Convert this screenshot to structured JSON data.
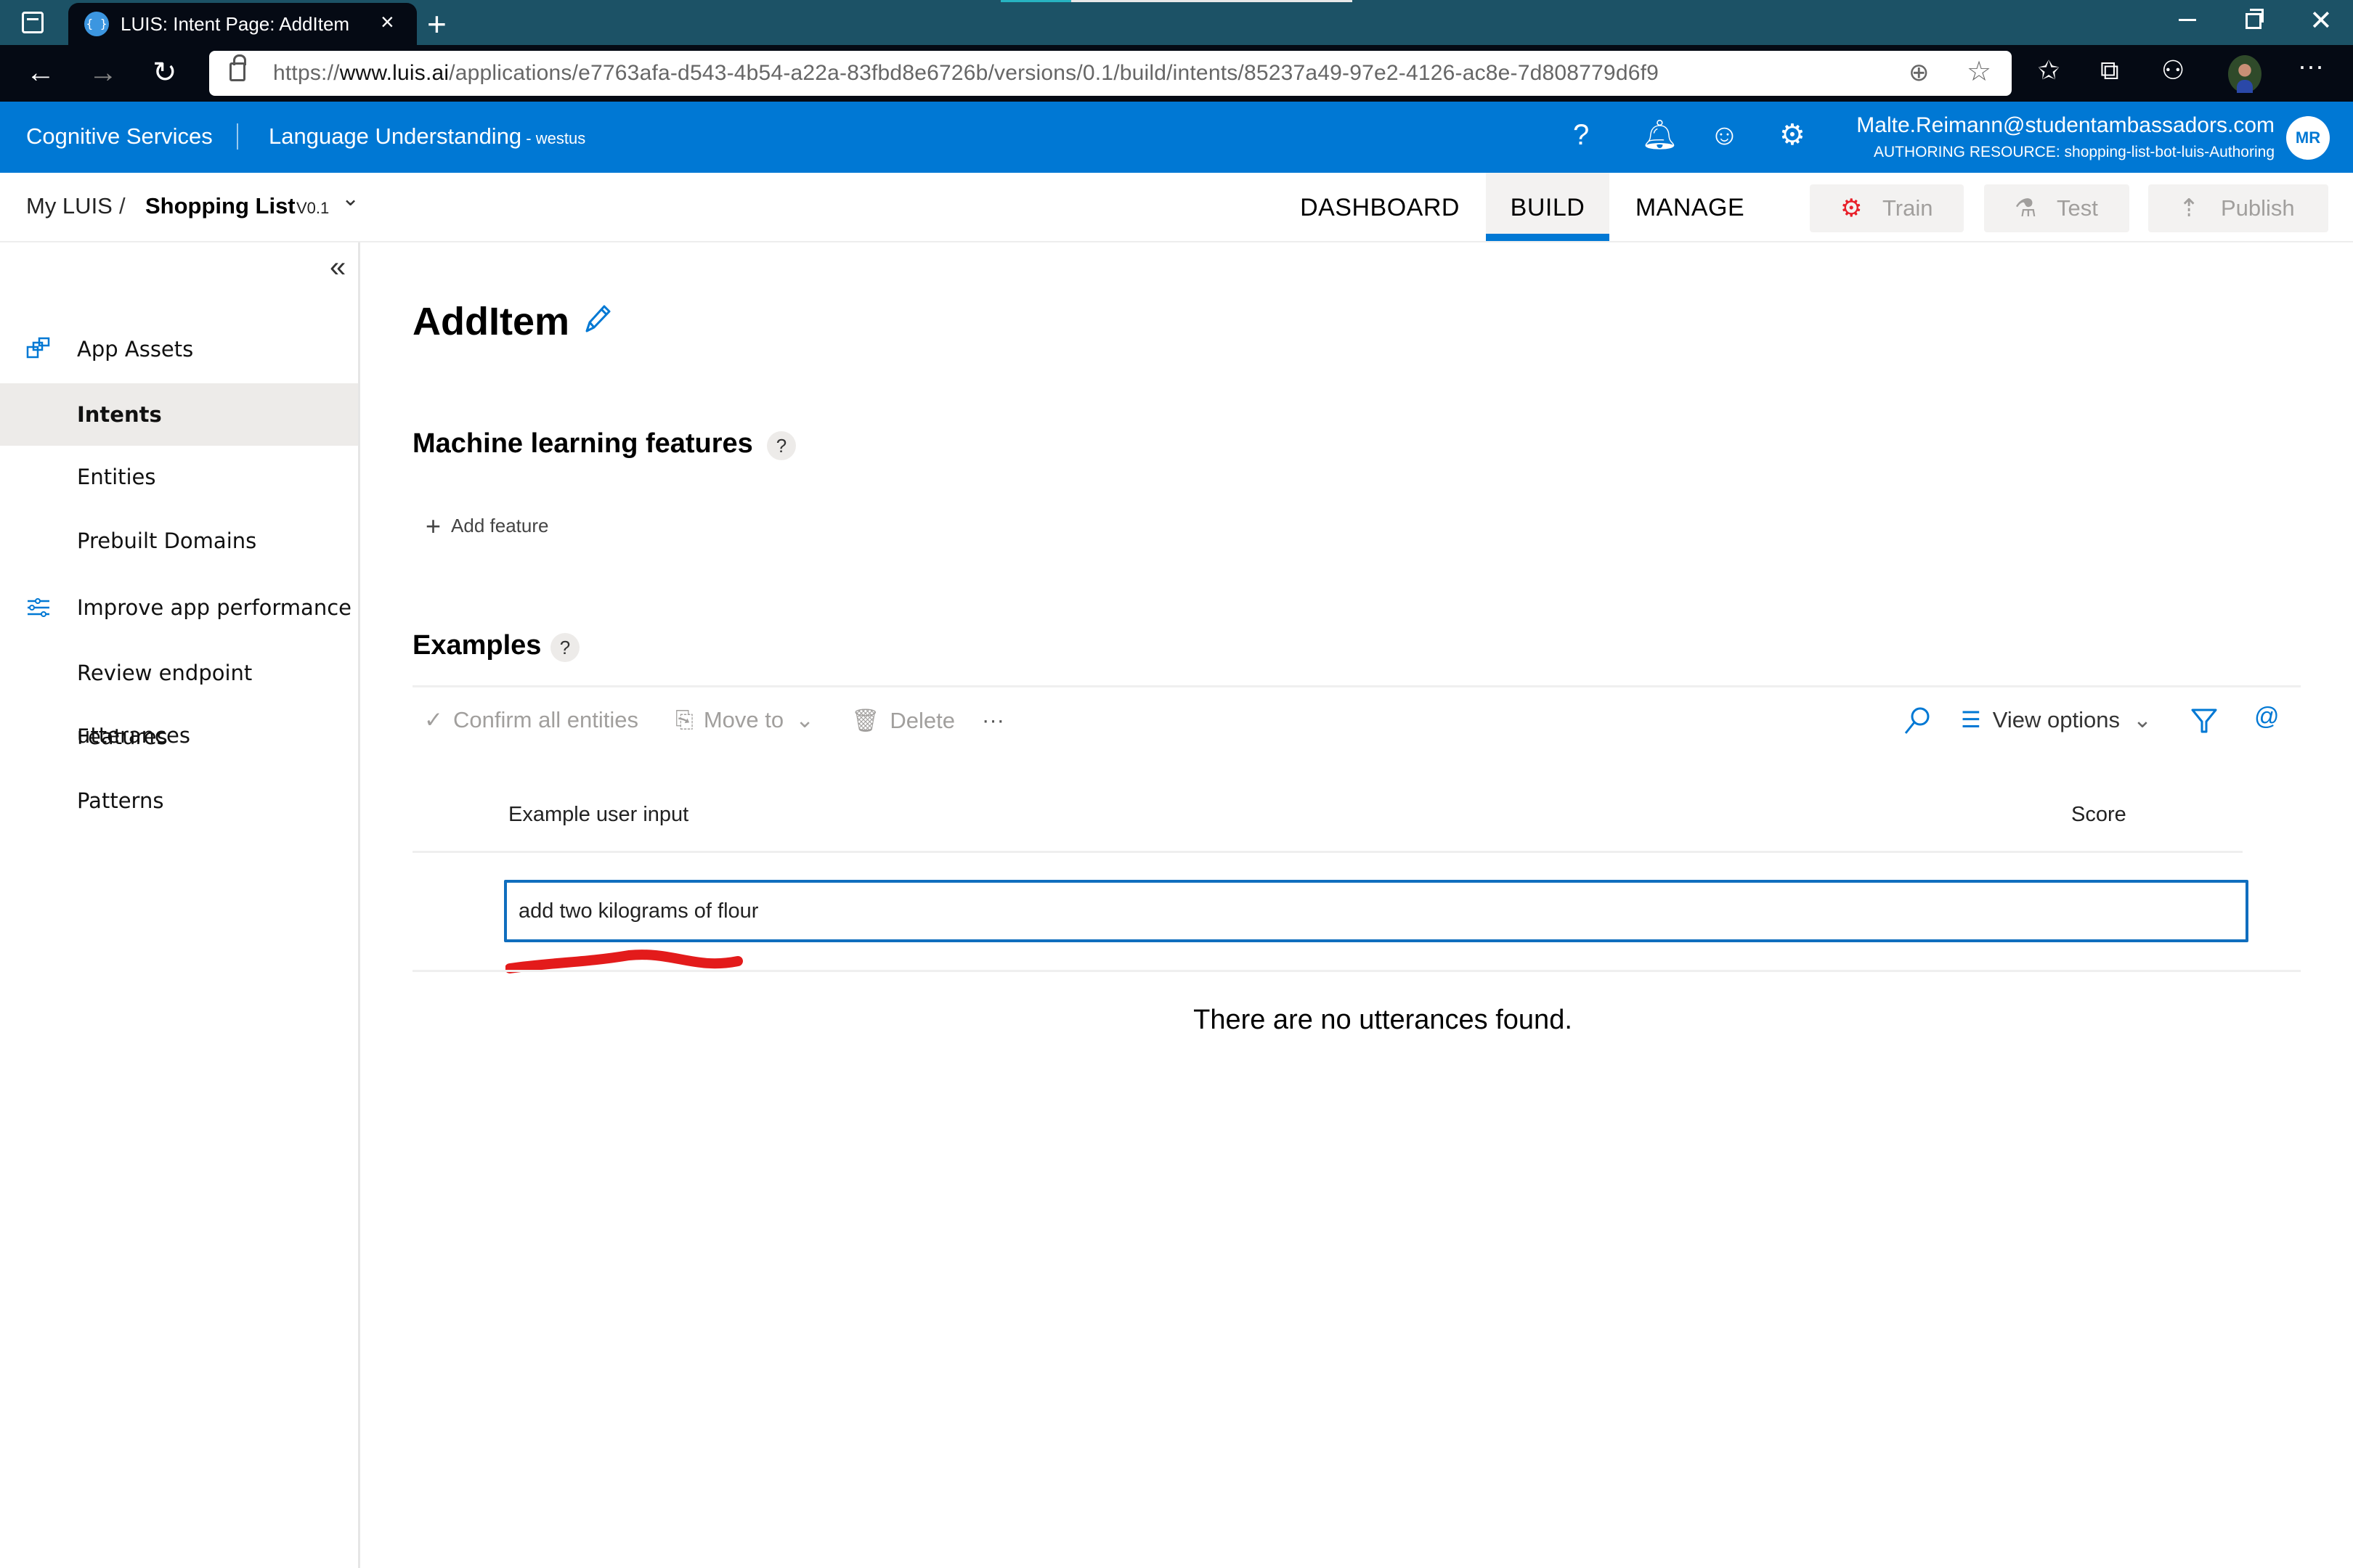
{
  "browser": {
    "tab_title": "LUIS: Intent Page: AddItem",
    "tab_favicon": "{ }",
    "new_tab_icon": "+",
    "close_tab_icon": "×",
    "page_load_progress": 0.2,
    "url_prefix": "https://",
    "url_domain": "www.luis.ai",
    "url_path": "/applications/e7763afa-d543-4b54-a22a-83fbd8e6726b/versions/0.1/build/intents/85237a49-97e2-4126-ac8e-7d808779d6f9",
    "toolbar_icons": [
      "favorites-icon",
      "collections-icon",
      "share-icon",
      "profile-avatar",
      "more-icon"
    ]
  },
  "header": {
    "brand": "Cognitive Services",
    "product": "Language Understanding",
    "region": " - westus",
    "user_email": "Malte.Reimann@studentambassadors.com",
    "authoring_resource": "AUTHORING RESOURCE:  shopping-list-bot-luis-Authoring",
    "user_initials": "MR"
  },
  "nav": {
    "breadcrumb_root": "My LUIS",
    "breadcrumb_sep": "/",
    "app_name": "Shopping List",
    "version": "V0.1",
    "tabs": [
      {
        "label": "DASHBOARD",
        "active": false
      },
      {
        "label": "BUILD",
        "active": true
      },
      {
        "label": "MANAGE",
        "active": false
      }
    ],
    "actions": {
      "train": "Train",
      "test": "Test",
      "publish": "Publish"
    }
  },
  "sidebar": {
    "collapse_icon": "«",
    "items": [
      {
        "label": "App Assets",
        "icon": "app-assets-icon",
        "active": false
      },
      {
        "label": "Intents",
        "active": true
      },
      {
        "label": "Entities",
        "active": false
      },
      {
        "label": "Prebuilt Domains",
        "active": false
      },
      {
        "label": "Improve app performance",
        "icon": "sliders-icon",
        "active": false
      },
      {
        "label": "Review endpoint utterances",
        "active": false
      },
      {
        "label": "Features",
        "active": false
      },
      {
        "label": "Patterns",
        "active": false
      }
    ]
  },
  "main": {
    "title": "AddItem",
    "ml_features_heading": "Machine learning features",
    "help_glyph": "?",
    "add_feature": "Add feature",
    "examples_heading": "Examples",
    "commands": {
      "confirm_all": "Confirm all entities",
      "move_to": "Move to",
      "delete": "Delete",
      "more": "···",
      "view_options": "View options"
    },
    "columns": {
      "example": "Example user input",
      "score": "Score"
    },
    "utterance_input_value": "add two kilograms of flour",
    "empty_message": "There are no utterances found."
  },
  "colors": {
    "brand_blue": "#0078d4",
    "tab_strip": "#1c5266",
    "address_bar_bg": "#050a14",
    "annotation_red": "#e31b1b",
    "train_icon_red": "#e8202a"
  }
}
